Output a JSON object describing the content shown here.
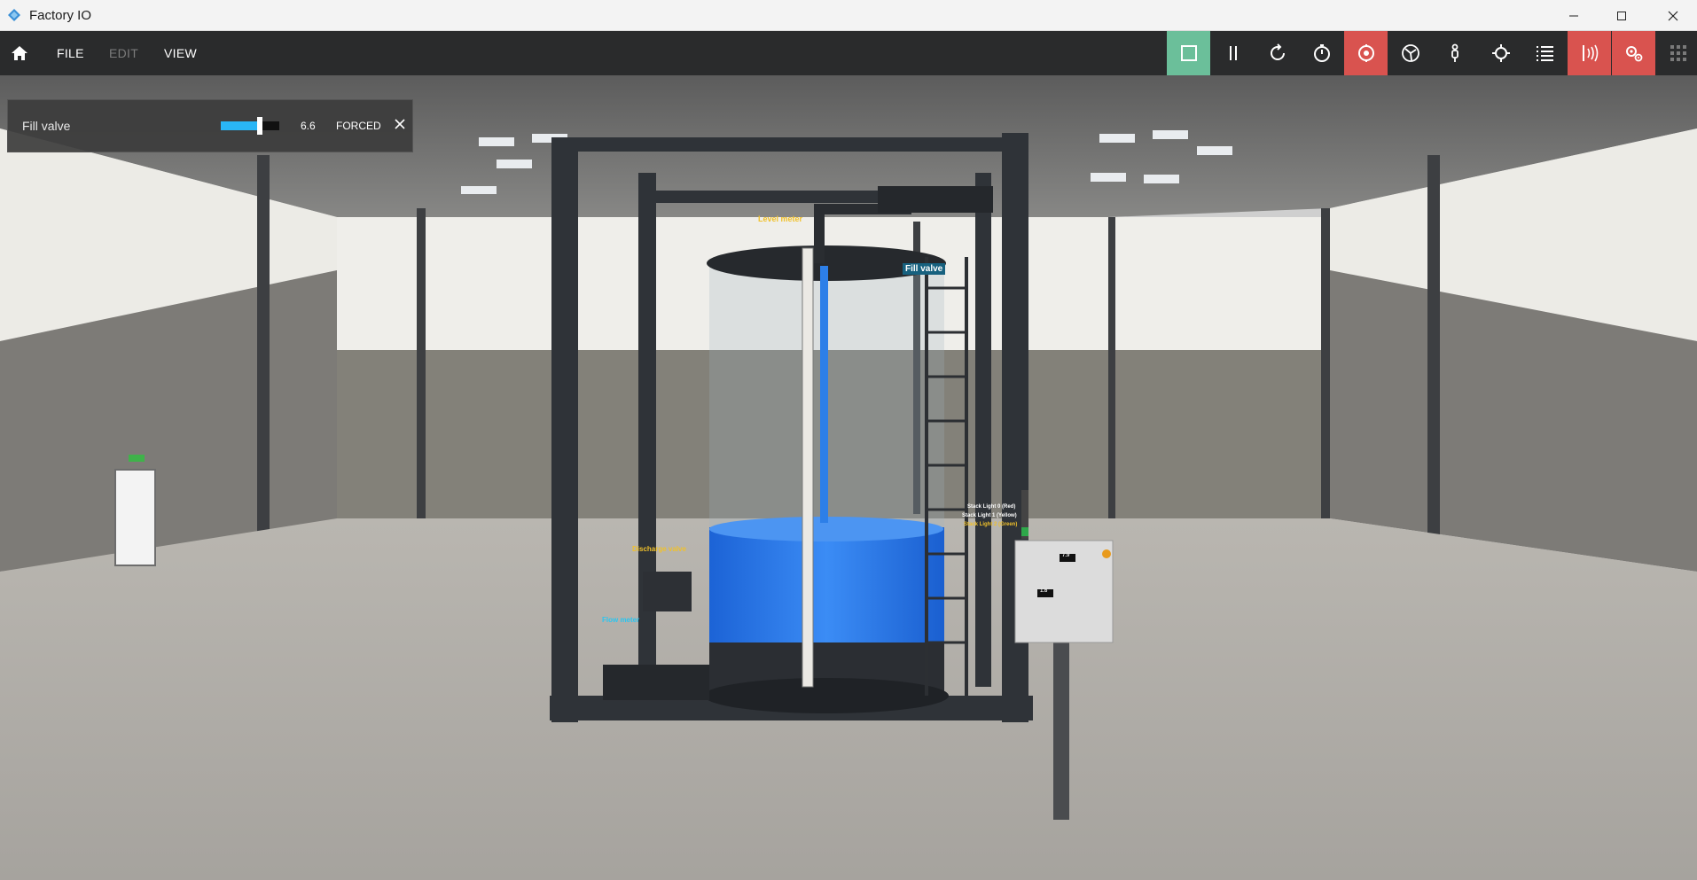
{
  "window": {
    "title": "Factory IO",
    "minimize_icon": "minimize-icon",
    "maximize_icon": "maximize-icon",
    "close_icon": "close-icon"
  },
  "menu": {
    "file": "FILE",
    "edit": "EDIT",
    "view": "VIEW"
  },
  "toolbar": {
    "buttons": [
      {
        "icon": "stop-icon",
        "state": "active",
        "color": "#6bbf9a"
      },
      {
        "icon": "pause-icon",
        "state": "normal"
      },
      {
        "icon": "reset-icon",
        "state": "normal"
      },
      {
        "icon": "timer-icon",
        "state": "normal"
      },
      {
        "icon": "camera-orbit-icon",
        "state": "active",
        "color": "#d9534f"
      },
      {
        "icon": "fly-camera-icon",
        "state": "normal"
      },
      {
        "icon": "first-person-icon",
        "state": "normal"
      },
      {
        "icon": "crosshair-icon",
        "state": "normal"
      },
      {
        "icon": "list-icon",
        "state": "normal"
      },
      {
        "icon": "sensor-labels-icon",
        "state": "active",
        "color": "#d9534f"
      },
      {
        "icon": "actuator-labels-icon",
        "state": "active",
        "color": "#d9534f"
      },
      {
        "icon": "grid-icon",
        "state": "normal"
      }
    ]
  },
  "fill_valve_panel": {
    "label": "Fill valve",
    "value": "6.6",
    "level": 0.66,
    "mode": "FORCED",
    "accent": "#29b6f6"
  },
  "scene_labels": {
    "level_meter": "Level meter",
    "fill_valve": "Fill valve",
    "discharge_valve": "Discharge valve",
    "flow_meter": "Flow meter",
    "stack_light_red": "Stack Light 0 (Red)",
    "stack_light_yellow": "Stack Light 1 (Yellow)",
    "stack_light_green": "Stack Light 2 (Green)",
    "display_1": "7.9",
    "display_2": "1.6"
  }
}
